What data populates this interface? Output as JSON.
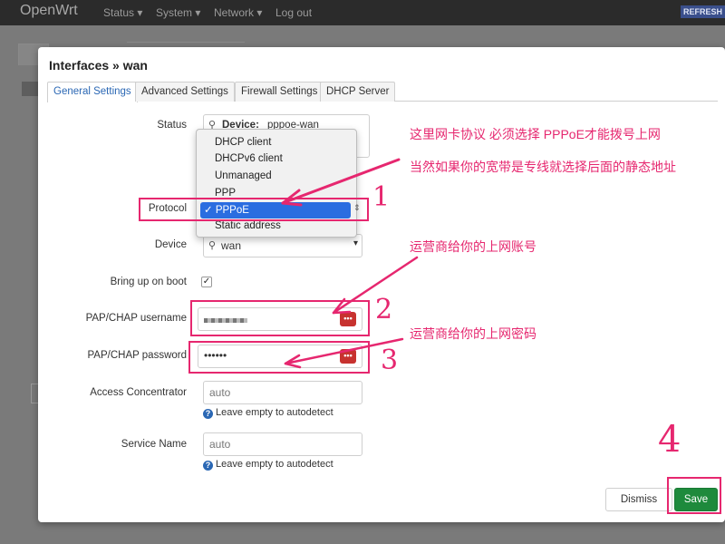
{
  "navbar": {
    "brand": "OpenWrt",
    "menu": [
      "Status",
      "System",
      "Network",
      "Log out"
    ],
    "refresh": "REFRESH"
  },
  "modal": {
    "title": "Interfaces » wan",
    "tabs": [
      "General Settings",
      "Advanced Settings",
      "Firewall Settings",
      "DHCP Server"
    ],
    "active_tab": "General Settings"
  },
  "form": {
    "status_label": "Status",
    "status_device_prefix": "Device:",
    "status_device": "pppoe-wan",
    "protocol_label": "Protocol",
    "protocol_options": [
      "DHCP client",
      "DHCPv6 client",
      "Unmanaged",
      "PPP",
      "PPPoE",
      "Static address"
    ],
    "protocol_selected": "PPPoE",
    "device_label": "Device",
    "device_value": "wan",
    "bring_up_label": "Bring up on boot",
    "bring_up_checked": true,
    "username_label": "PAP/CHAP username",
    "password_label": "PAP/CHAP password",
    "password_value": "••••••",
    "ac_label": "Access Concentrator",
    "ac_placeholder": "auto",
    "ac_hint": "Leave empty to autodetect",
    "service_label": "Service Name",
    "service_placeholder": "auto",
    "service_hint": "Leave empty to autodetect"
  },
  "footer": {
    "dismiss": "Dismiss",
    "save": "Save"
  },
  "annotations": {
    "note1_line1": "这里网卡协议 必须选择 PPPoE才能拨号上网",
    "note1_line2": "当然如果你的宽带是专线就选择后面的静态地址",
    "note2": "运营商给你的上网账号",
    "note3": "运营商给你的上网密码",
    "num1": "1",
    "num2": "2",
    "num3": "3",
    "num4": "4"
  },
  "colors": {
    "annotation": "#e6276f",
    "save_button": "#1e8a3c",
    "selected_option": "#2a6de0",
    "active_tab_text": "#2a67b4"
  }
}
